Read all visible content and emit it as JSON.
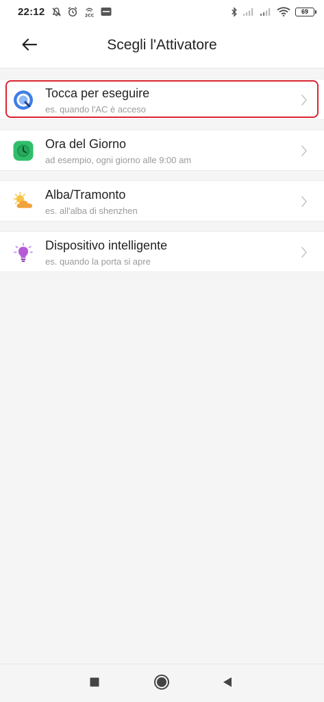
{
  "status_bar": {
    "time": "22:12",
    "battery": "69",
    "left_icons": [
      "muted-bell-icon",
      "alarm-clock-icon",
      "hotspot-icon",
      "notification-app-icon"
    ],
    "right_icons": [
      "bluetooth-icon",
      "signal-icon",
      "signal-icon",
      "wifi-icon",
      "battery-icon"
    ]
  },
  "header": {
    "title": "Scegli l'Attivatore",
    "back_icon": "arrow-left-icon"
  },
  "triggers": [
    {
      "title": "Tocca per eseguire",
      "subtitle": "es. quando l'AC è acceso",
      "icon": "tap-to-run-icon",
      "selected": true
    },
    {
      "title": "Ora del Giorno",
      "subtitle": "ad esempio, ogni giorno alle 9:00 am",
      "icon": "clock-icon"
    },
    {
      "title": "Alba/Tramonto",
      "subtitle": "es. all'alba di shenzhen",
      "icon": "sun-cloud-icon"
    },
    {
      "title": "Dispositivo intelligente",
      "subtitle": "es. quando la porta si apre",
      "icon": "lightbulb-icon"
    }
  ],
  "colors": {
    "highlight": "#d9232f",
    "tap_icon": "#3f7fe6",
    "clock_icon": "#2fbf6b",
    "sun_icon": "#f6b43b",
    "bulb_icon": "#b55ad8",
    "subtitle_text": "#9a9a9a"
  },
  "nav_bar": {
    "buttons": [
      "recents-square-icon",
      "home-circle-icon",
      "back-triangle-icon"
    ]
  }
}
